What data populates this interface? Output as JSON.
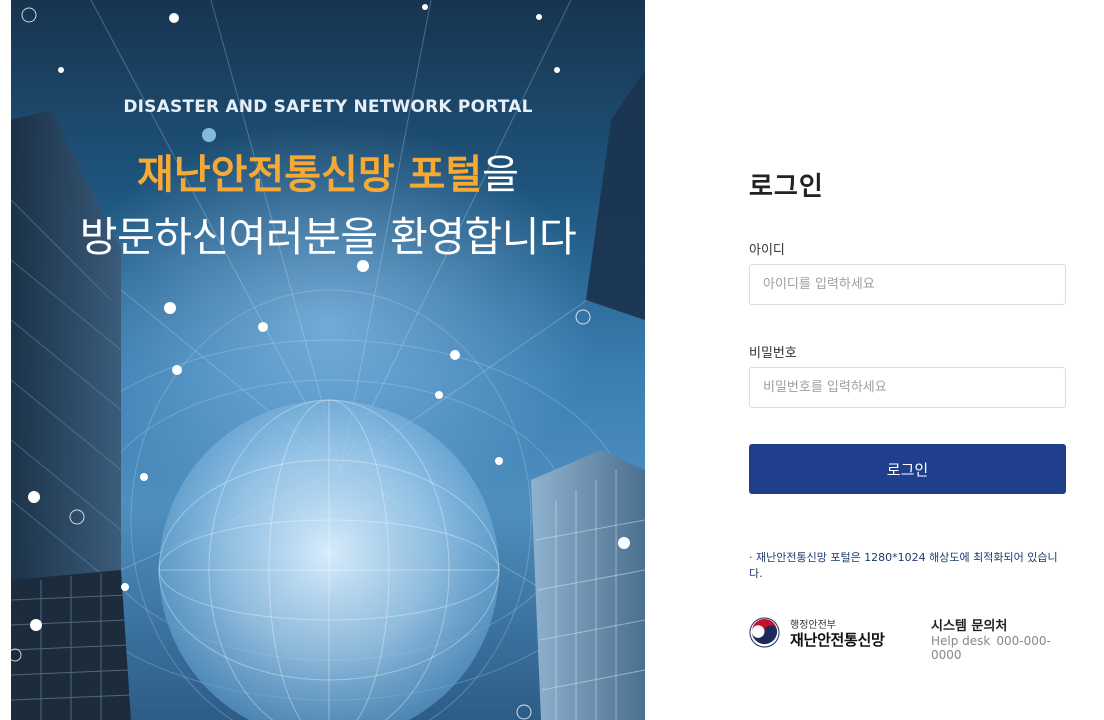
{
  "hero": {
    "subtitle": "DISASTER AND SAFETY NETWORK PORTAL",
    "title_highlight": "재난안전통신망 포털",
    "title_tail": "을",
    "welcome": "방문하신여러분을 환영합니다"
  },
  "login": {
    "title": "로그인",
    "id_label": "아이디",
    "id_placeholder": "아이디를 입력하세요",
    "pw_label": "비밀번호",
    "pw_placeholder": "비밀번호를 입력하세요",
    "button_label": "로그인",
    "notice": "· 재난안전통신망 포털은 1280*1024 해상도에 최적화되어 있습니다."
  },
  "footer": {
    "ministry": "행정안전부",
    "org": "재난안전통신망",
    "contact_title": "시스템 문의처",
    "help_label": "Help desk",
    "help_number": "000-000-0000"
  },
  "colors": {
    "accent": "#f7a935",
    "primary_button": "#1f3f8c",
    "notice_text": "#1e3a70"
  },
  "icons": [
    "government-emblem-icon"
  ]
}
